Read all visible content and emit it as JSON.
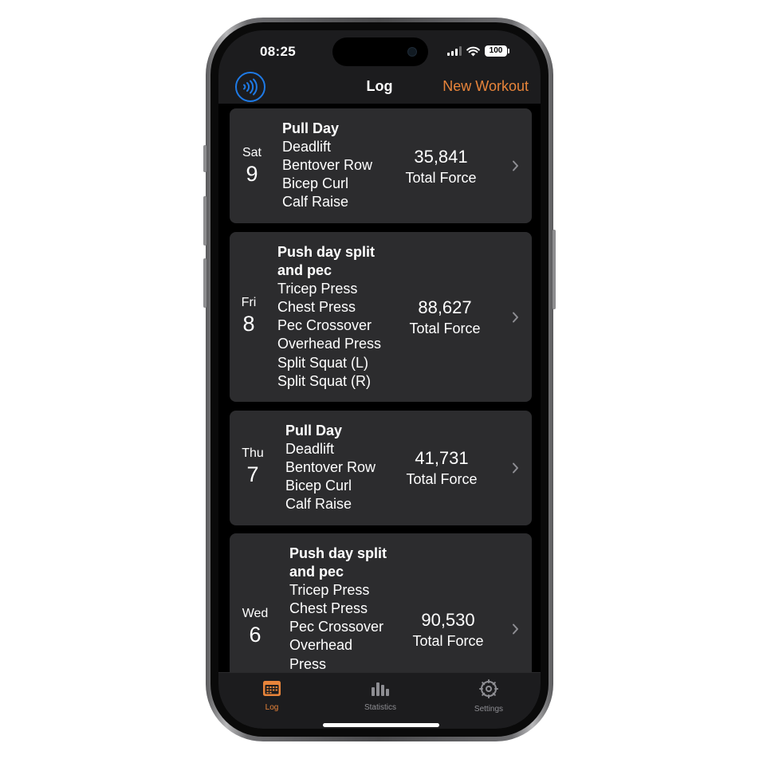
{
  "status_bar": {
    "time": "08:25",
    "battery": "100"
  },
  "nav": {
    "title": "Log",
    "action": "New Workout",
    "left_icon": "nfc-tap-icon",
    "accent": "#e8843a",
    "icon_color": "#1e7ae6"
  },
  "workouts": [
    {
      "dow": "Sat",
      "day": "9",
      "name": "Pull Day",
      "name_lines": [
        "Pull Day"
      ],
      "exercises": [
        "Deadlift",
        "Bentover Row",
        "Bicep Curl",
        "Calf Raise"
      ],
      "force": "35,841",
      "force_label": "Total Force"
    },
    {
      "dow": "Fri",
      "day": "8",
      "name": "Push day split and pec",
      "name_lines": [
        "Push day split",
        "and pec"
      ],
      "exercises": [
        "Tricep Press",
        "Chest Press",
        "Pec Crossover",
        "Overhead Press",
        "Split Squat (L)",
        "Split Squat (R)"
      ],
      "force": "88,627",
      "force_label": "Total Force"
    },
    {
      "dow": "Thu",
      "day": "7",
      "name": "Pull Day",
      "name_lines": [
        "Pull Day"
      ],
      "exercises": [
        "Deadlift",
        "Bentover Row",
        "Bicep Curl",
        "Calf Raise"
      ],
      "force": "41,731",
      "force_label": "Total Force"
    },
    {
      "dow": "Wed",
      "day": "6",
      "name": "Push day split and pec",
      "name_lines": [
        "Push day split",
        "and pec"
      ],
      "exercises": [
        "Tricep Press",
        "Chest Press",
        "Pec Crossover",
        "Overhead",
        "Press"
      ],
      "force": "90,530",
      "force_label": "Total Force"
    }
  ],
  "tabs": [
    {
      "label": "Log",
      "icon": "calendar-icon",
      "active": true
    },
    {
      "label": "Statistics",
      "icon": "bar-chart-icon",
      "active": false
    },
    {
      "label": "Settings",
      "icon": "gear-icon",
      "active": false
    }
  ],
  "colors": {
    "active_tab": "#e8843a",
    "inactive_tab": "#8e8e93",
    "card_bg": "#2c2c2e"
  }
}
